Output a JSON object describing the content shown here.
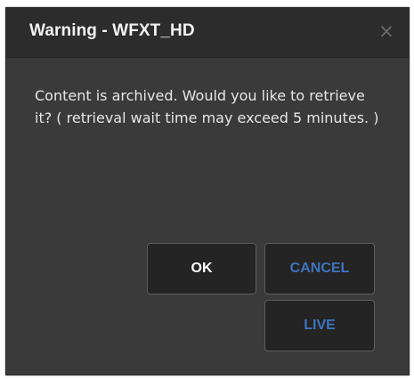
{
  "dialog": {
    "title": "Warning - WFXT_HD",
    "close_glyph": "×",
    "message": "Content is archived. Would you like to retrieve it? ( retrieval wait time may exceed 5 minutes. )",
    "buttons": {
      "ok": "OK",
      "cancel": "CANCEL",
      "live": "LIVE"
    }
  },
  "colors": {
    "dialog_bg": "#3a3a3a",
    "titlebar_bg": "#2c2c2c",
    "button_bg": "#242424",
    "accent_blue": "#3f74c0",
    "text": "#e6e6e6"
  },
  "icons": {
    "close": "close-icon"
  }
}
